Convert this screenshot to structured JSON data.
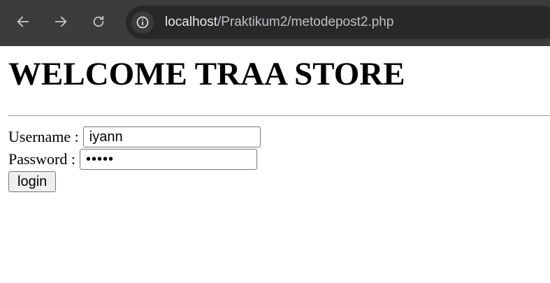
{
  "browser": {
    "url_host": "localhost",
    "url_path": "/Praktikum2/metodepost2.php",
    "icons": {
      "back": "arrow-left-icon",
      "forward": "arrow-right-icon",
      "reload": "reload-icon",
      "site_info": "info-icon"
    }
  },
  "page": {
    "title": "WELCOME TRAA STORE",
    "form": {
      "username_label": "Username :",
      "username_value": "iyann",
      "password_label": "Password :",
      "password_value": "iyann",
      "submit_label": "login"
    }
  }
}
